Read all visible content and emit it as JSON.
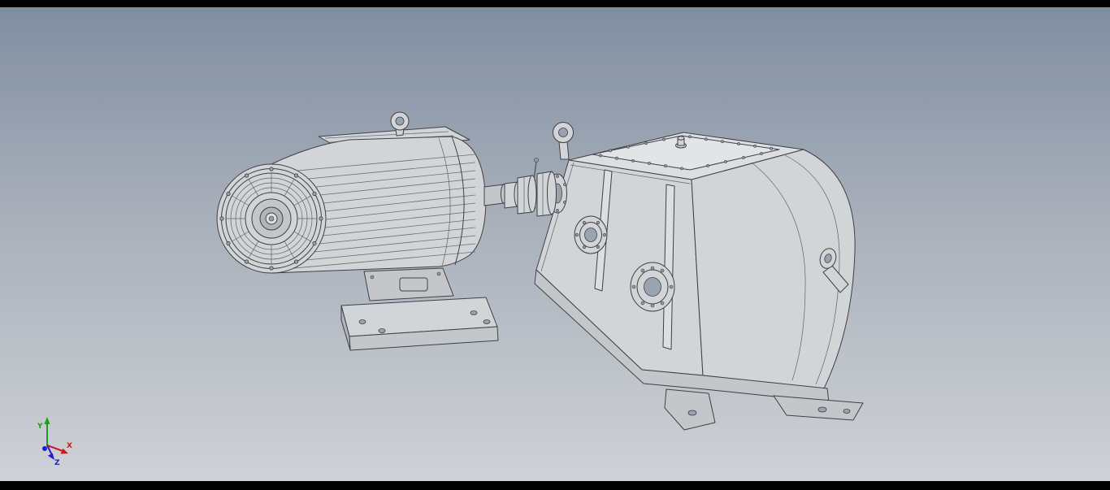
{
  "viewport": {
    "background_top": "#7f8ca0",
    "background_mid": "#a9b0ba",
    "background_bottom": "#d0d3d7",
    "letterbox_color": "#000000"
  },
  "model": {
    "outline_color": "#3f4145",
    "surface_light": "#dcdee1",
    "surface_mid": "#d2d4d7",
    "surface_dark": "#c4c6c9"
  },
  "triad": {
    "x": {
      "label": "X",
      "color": "#cc1a1a"
    },
    "y": {
      "label": "Y",
      "color": "#18a018"
    },
    "z": {
      "label": "Z",
      "color": "#2020cc"
    }
  }
}
